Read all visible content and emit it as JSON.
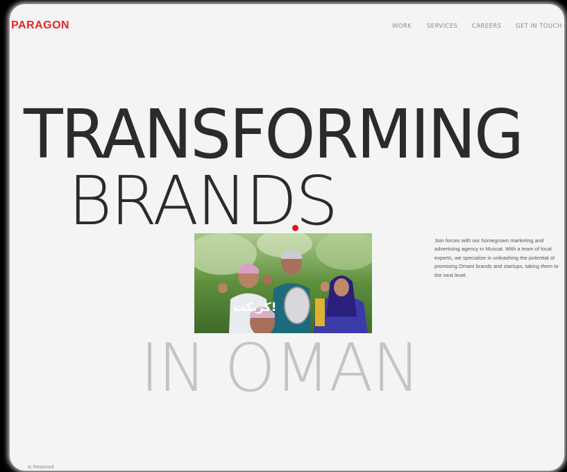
{
  "header": {
    "logo": "PARAGON",
    "nav": [
      {
        "label": "WORK"
      },
      {
        "label": "SERVICES"
      },
      {
        "label": "CAREERS"
      },
      {
        "label": "GET IN TOUCH"
      }
    ]
  },
  "hero": {
    "line1": "TRANSFORMING",
    "line2": "BRANDS",
    "line3": "IN OMAN"
  },
  "media": {
    "overlay_text": "كريكت!"
  },
  "blurb": "Join forces with our homegrown marketing and advertising agency in Muscat. With a team of local experts, we specialize in unleashing the potential of promising Omani brands and startups, taking them to the next level.",
  "footer": {
    "text": "ts Reserved"
  },
  "colors": {
    "brand": "#e0282a",
    "heading": "#2b2b2b",
    "heading_muted": "#c4c4c4",
    "background": "#f4f4f4"
  }
}
